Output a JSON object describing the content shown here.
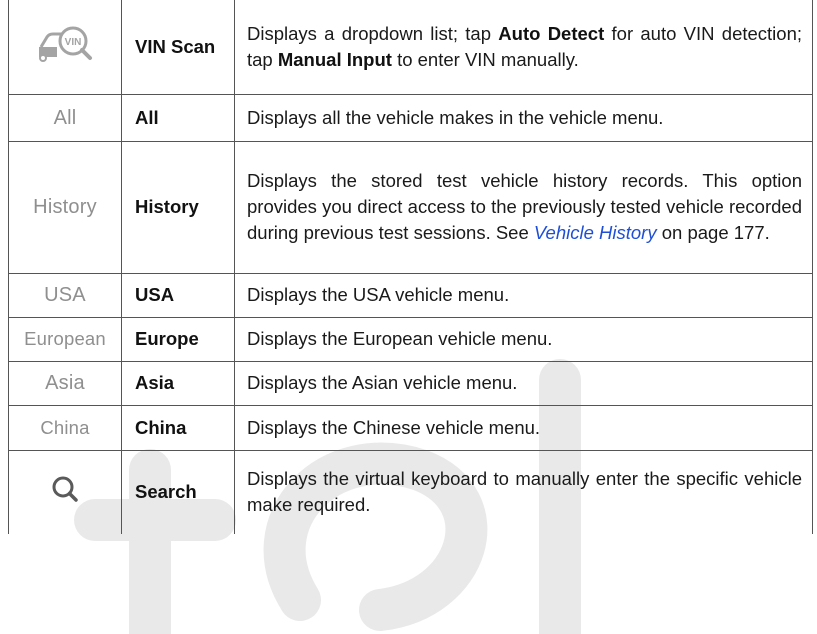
{
  "rows": [
    {
      "icon": "vin-scan-icon",
      "name": "VIN Scan",
      "desc": {
        "t1": "Displays a dropdown list; tap ",
        "b1": "Auto Detect",
        "t2": " for auto VIN detection; tap ",
        "b2": "Manual Input",
        "t3": " to enter VIN manually."
      }
    },
    {
      "icon_label": "All",
      "name": "All",
      "desc": "Displays all the vehicle makes in the vehicle menu."
    },
    {
      "icon_label": "History",
      "name": "History",
      "desc": {
        "t1": "Displays the stored test vehicle history records. This option provides you direct access to the previously tested vehicle recorded during previous test sessions. See ",
        "link": "Vehicle History",
        "t2": " on page 177."
      }
    },
    {
      "icon_label": "USA",
      "name": "USA",
      "desc": "Displays the USA vehicle menu."
    },
    {
      "icon_label": "European",
      "name": "Europe",
      "desc": "Displays the European vehicle menu."
    },
    {
      "icon_label": "Asia",
      "name": "Asia",
      "desc": "Displays the Asian vehicle menu."
    },
    {
      "icon_label": "China",
      "name": "China",
      "desc": "Displays the Chinese vehicle menu."
    },
    {
      "icon": "search-icon",
      "name": "Search",
      "desc": "Displays the virtual keyboard to manually enter the specific vehicle make required."
    }
  ],
  "vin_icon_text": "VIN",
  "colors": {
    "link": "#1f4fd6",
    "icon_gray": "#8f8f8f",
    "border": "#555555"
  }
}
